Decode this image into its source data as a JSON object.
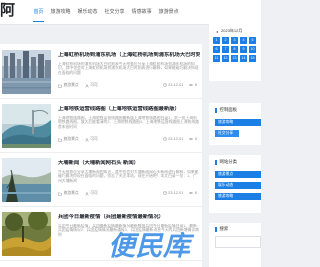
{
  "brand": {
    "logo_text": "阿"
  },
  "nav": {
    "items": [
      "首页",
      "旅游攻略",
      "娱乐动态",
      "社交分享",
      "情感故事",
      "旅游景点"
    ],
    "active_index": 0
  },
  "posts": [
    {
      "title": "上海虹桥机场到浦东机场（上海虹桥机场到浦东机场大巴时刻表）",
      "excerpt": "上海虹桥机场到浦东机场大巴时刻表今天给各位分享上海虹桥机场到浦东机场的知识，其中也会对上海虹桥机场到浦东机场大巴时刻表进行解释，如果能碰巧解决你现在面临的问题",
      "category": "旅游景点",
      "read": "可可",
      "date": "23-12-01",
      "views": "8"
    },
    {
      "title": "上海地铁运营线路图（上海地铁运营线路图最新版）",
      "excerpt": "上海地铁线路图，上海地铁运营线路图最新版上海地铁线路图目录1、求一张上海市地铁路线图，放大后能看清的2、上海地铁线路图3、上海地铁运营线路图上海各线路首末班时间",
      "category": "旅游景点",
      "read": "可可",
      "date": "23-12-01",
      "views": "6"
    },
    {
      "title": "大埔新闻（大埔新闻网石头 新闻）",
      "excerpt": "今天给各位分享大埔新闻的知识，其中也会对大埔新闻网石头新闻进行解释，如果能碰巧解决你现在面临的问题，别忘了关注本站，现在开始吧！本文目录一览：1、广州大埔新闻",
      "category": "旅游景点",
      "read": "可可",
      "date": "23-12-01",
      "views": "6"
    },
    {
      "title": "兵团今日最新疫情（兵团最新疫情最新情况）",
      "excerpt": "兵团今日最新疫情，兵团最新疫情最新情况最新数据兵团今日最新疫情目录1、最新兵团疫情情况2、兵团疫情情况最新通报3、兵团疫情最新消息今天的兵团新增确诊病例",
      "category": "旅游景点",
      "read": "可可",
      "date": "23-12-01",
      "views": "6"
    }
  ],
  "calendar": {
    "title": "2023年12月",
    "days": [
      "1",
      "2",
      "3",
      "4",
      "5",
      "6",
      "7",
      "8",
      "9",
      "10",
      "11",
      "12",
      "13",
      "14",
      "15"
    ]
  },
  "widgets": {
    "tags_title": "控制面板",
    "tags": [
      "旅游攻略",
      "社交分享"
    ],
    "category_title": "网站分类",
    "categories": [
      "旅游景点",
      "娱乐动态",
      "旅游攻略"
    ],
    "search_title": "搜索"
  },
  "watermark": {
    "text": "便民库"
  },
  "colors": {
    "accent": "#1b7fe6",
    "page_bg": "#eef0f3",
    "watermark": "#3b8de6"
  }
}
